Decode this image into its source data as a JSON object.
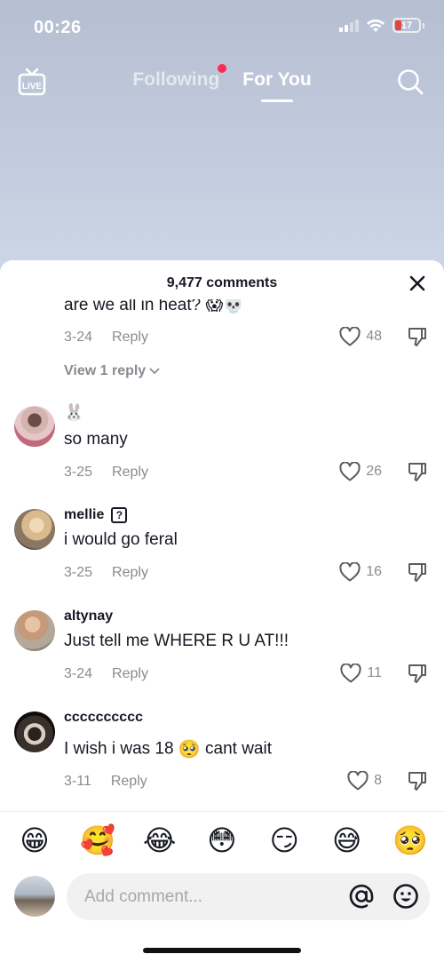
{
  "status_bar": {
    "time": "00:26",
    "battery": "17",
    "battery_color": "#e8423a"
  },
  "top_nav": {
    "live_label": "LIVE",
    "tabs": [
      {
        "label": "Following"
      },
      {
        "label": "For You"
      }
    ],
    "active_tab": "For You"
  },
  "sheet": {
    "title": "9,477 comments"
  },
  "comments": [
    {
      "user": "",
      "text": "are we all in heat? 😱💀",
      "date": "3-24",
      "reply_label": "Reply",
      "likes": "48",
      "view_replies": "View 1 reply"
    },
    {
      "user": "🐰",
      "text": "so many",
      "date": "3-25",
      "reply_label": "Reply",
      "likes": "26"
    },
    {
      "user": "mellie",
      "badge": "?",
      "text": "i would go feral",
      "date": "3-25",
      "reply_label": "Reply",
      "likes": "16"
    },
    {
      "user": "altynay",
      "text": "Just tell me WHERE R U AT!!!",
      "date": "3-24",
      "reply_label": "Reply",
      "likes": "11"
    },
    {
      "user": "cccccccccc",
      "text_before": "I wish i was 18",
      "text_emoji": "🥺",
      "text_after": "cant wait",
      "date": "3-11",
      "reply_label": "Reply",
      "likes": "8"
    }
  ],
  "emoji_bar": [
    "😁",
    "🥰",
    "😂",
    "😳",
    "😏",
    "😅",
    "🥺"
  ],
  "input": {
    "placeholder": "Add comment..."
  },
  "colors": {
    "accent": "#fe2c55",
    "muted": "#8a8b91"
  }
}
